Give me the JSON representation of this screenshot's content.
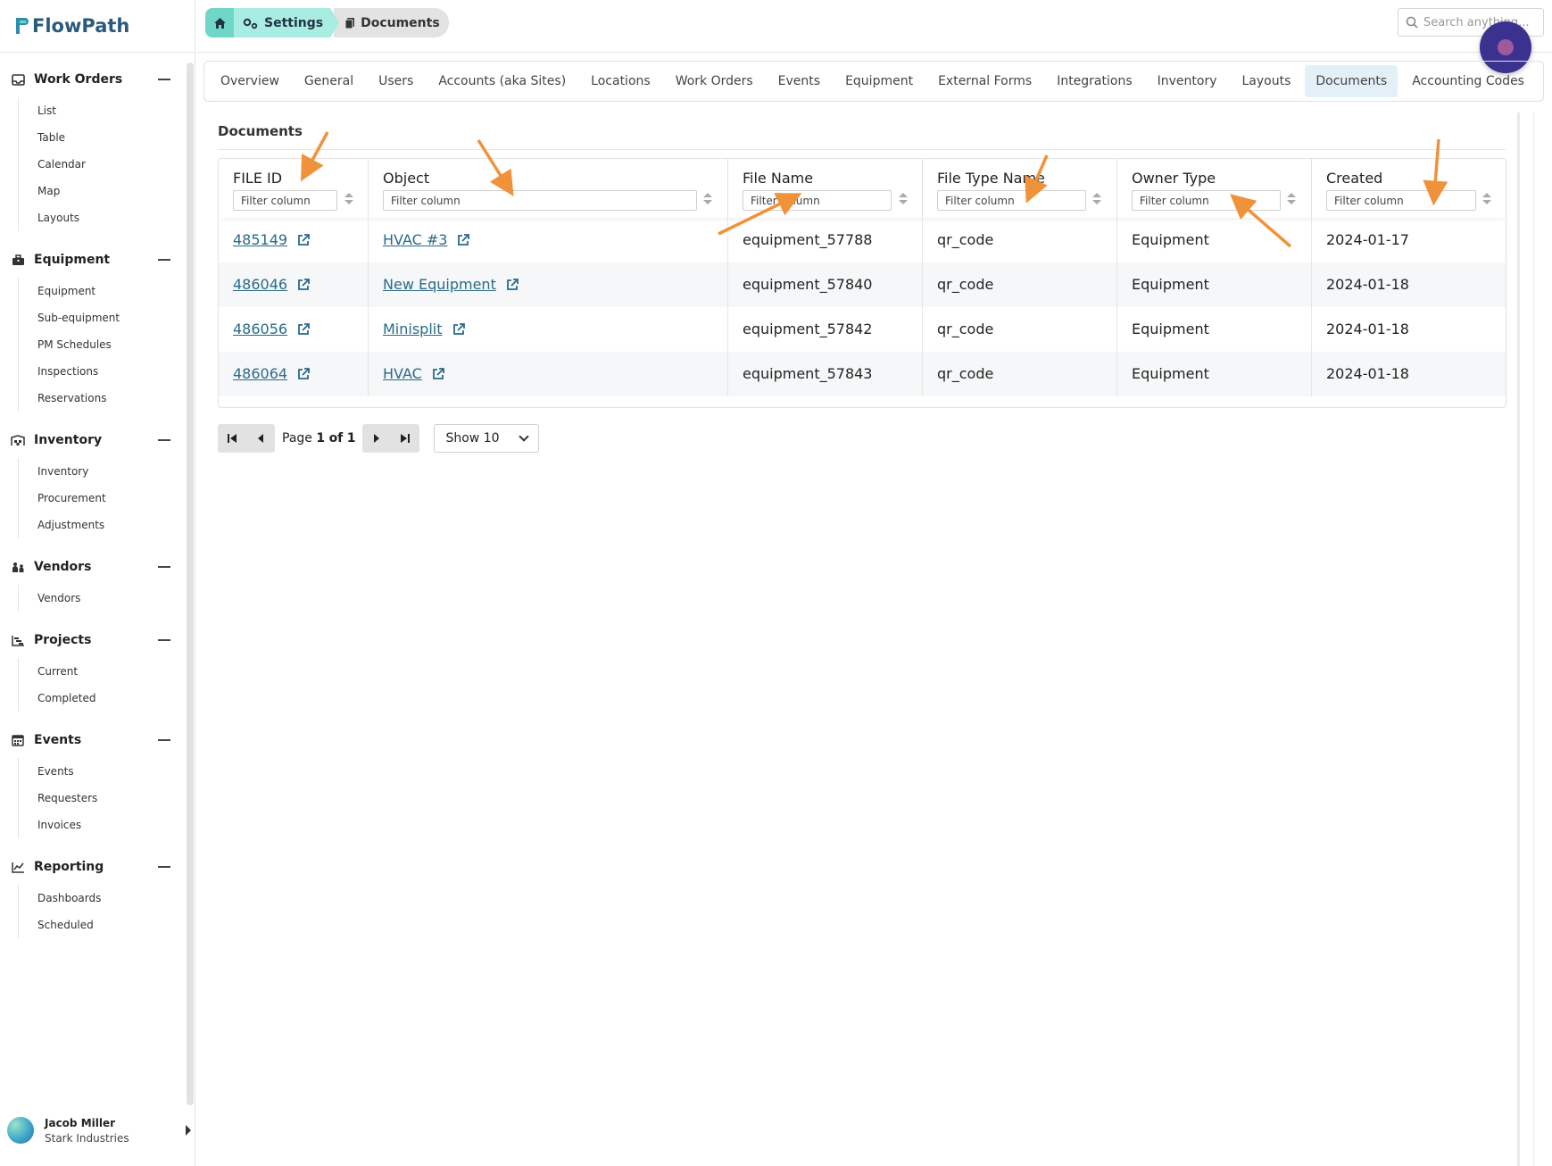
{
  "app": {
    "name": "FlowPath",
    "brand_color": "#2b5a7c",
    "accent_color": "#6fd6c8"
  },
  "breadcrumb": {
    "home_icon": "home-icon",
    "settings_label": "Settings",
    "documents_label": "Documents"
  },
  "search": {
    "placeholder": "Search anything..."
  },
  "sidebar": {
    "sections": [
      {
        "title": "Work Orders",
        "icon": "inbox-icon",
        "items": [
          "List",
          "Table",
          "Calendar",
          "Map",
          "Layouts"
        ]
      },
      {
        "title": "Equipment",
        "icon": "toolbox-icon",
        "items": [
          "Equipment",
          "Sub-equipment",
          "PM Schedules",
          "Inspections",
          "Reservations"
        ]
      },
      {
        "title": "Inventory",
        "icon": "warehouse-icon",
        "items": [
          "Inventory",
          "Procurement",
          "Adjustments"
        ]
      },
      {
        "title": "Vendors",
        "icon": "people-icon",
        "items": [
          "Vendors"
        ]
      },
      {
        "title": "Projects",
        "icon": "gantt-icon",
        "items": [
          "Current",
          "Completed"
        ]
      },
      {
        "title": "Events",
        "icon": "calendar-icon",
        "items": [
          "Events",
          "Requesters",
          "Invoices"
        ]
      },
      {
        "title": "Reporting",
        "icon": "line-chart-icon",
        "items": [
          "Dashboards",
          "Scheduled"
        ]
      }
    ]
  },
  "user": {
    "name": "Jacob Miller",
    "org": "Stark Industries"
  },
  "tabs": [
    {
      "label": "Overview",
      "active": false
    },
    {
      "label": "General",
      "active": false
    },
    {
      "label": "Users",
      "active": false
    },
    {
      "label": "Accounts (aka Sites)",
      "active": false
    },
    {
      "label": "Locations",
      "active": false
    },
    {
      "label": "Work Orders",
      "active": false
    },
    {
      "label": "Events",
      "active": false
    },
    {
      "label": "Equipment",
      "active": false
    },
    {
      "label": "External Forms",
      "active": false
    },
    {
      "label": "Integrations",
      "active": false
    },
    {
      "label": "Inventory",
      "active": false
    },
    {
      "label": "Layouts",
      "active": false
    },
    {
      "label": "Documents",
      "active": true
    },
    {
      "label": "Accounting Codes",
      "active": false
    }
  ],
  "documents": {
    "title": "Documents",
    "filter_placeholder": "Filter column",
    "columns": [
      "FILE ID",
      "Object",
      "File Name",
      "File Type Name",
      "Owner Type",
      "Created"
    ],
    "rows": [
      {
        "file_id": "485149",
        "object": "HVAC #3",
        "file_name": "equipment_57788",
        "file_type": "qr_code",
        "owner_type": "Equipment",
        "created": "2024-01-17"
      },
      {
        "file_id": "486046",
        "object": "New Equipment",
        "file_name": "equipment_57840",
        "file_type": "qr_code",
        "owner_type": "Equipment",
        "created": "2024-01-18"
      },
      {
        "file_id": "486056",
        "object": "Minisplit",
        "file_name": "equipment_57842",
        "file_type": "qr_code",
        "owner_type": "Equipment",
        "created": "2024-01-18"
      },
      {
        "file_id": "486064",
        "object": "HVAC",
        "file_name": "equipment_57843",
        "file_type": "qr_code",
        "owner_type": "Equipment",
        "created": "2024-01-18"
      }
    ]
  },
  "pagination": {
    "page_prefix": "Page",
    "page_current": "1",
    "page_of": "of",
    "page_total": "1",
    "show_label": "Show 10"
  },
  "annotation_color": "#f0923a"
}
